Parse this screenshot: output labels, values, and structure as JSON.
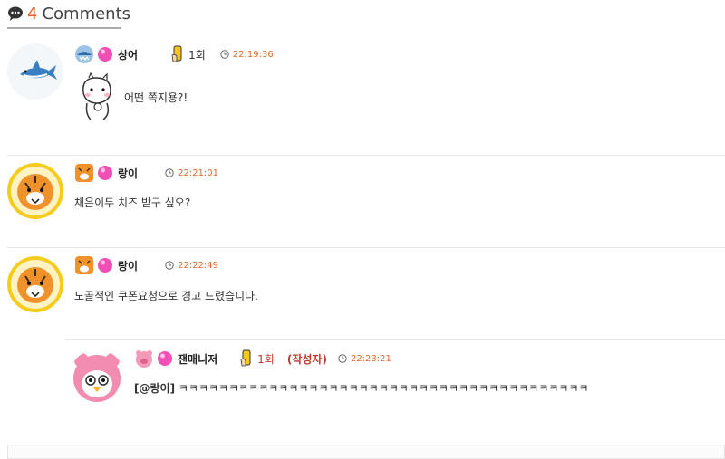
{
  "header": {
    "count": "4",
    "title": "Comments"
  },
  "comments": [
    {
      "nickname": "상어",
      "badge": "1회",
      "time": "22:19:36",
      "text": "어떤 쪽지용?!"
    },
    {
      "nickname": "랑이",
      "time": "22:21:01",
      "text": "채은이두 치즈 받구 싶오?"
    },
    {
      "nickname": "랑이",
      "time": "22:22:49",
      "text": "노골적인 쿠폰요청으로 경고 드렸습니다."
    },
    {
      "nickname": "잰매니저",
      "badge": "1회",
      "author_tag": "(작성자)",
      "time": "22:23:21",
      "mention": "[@랑이]",
      "text": "ㅋㅋㅋㅋㅋㅋㅋㅋㅋㅋㅋㅋㅋㅋㅋㅋㅋㅋㅋㅋㅋㅋㅋㅋㅋㅋㅋㅋㅋㅋㅋㅋㅋㅋㅋㅋㅋㅋㅋㅋㅋ"
    }
  ],
  "colors": {
    "accent": "#e85c2a",
    "author": "#c0392b",
    "time": "#e06a2c"
  }
}
